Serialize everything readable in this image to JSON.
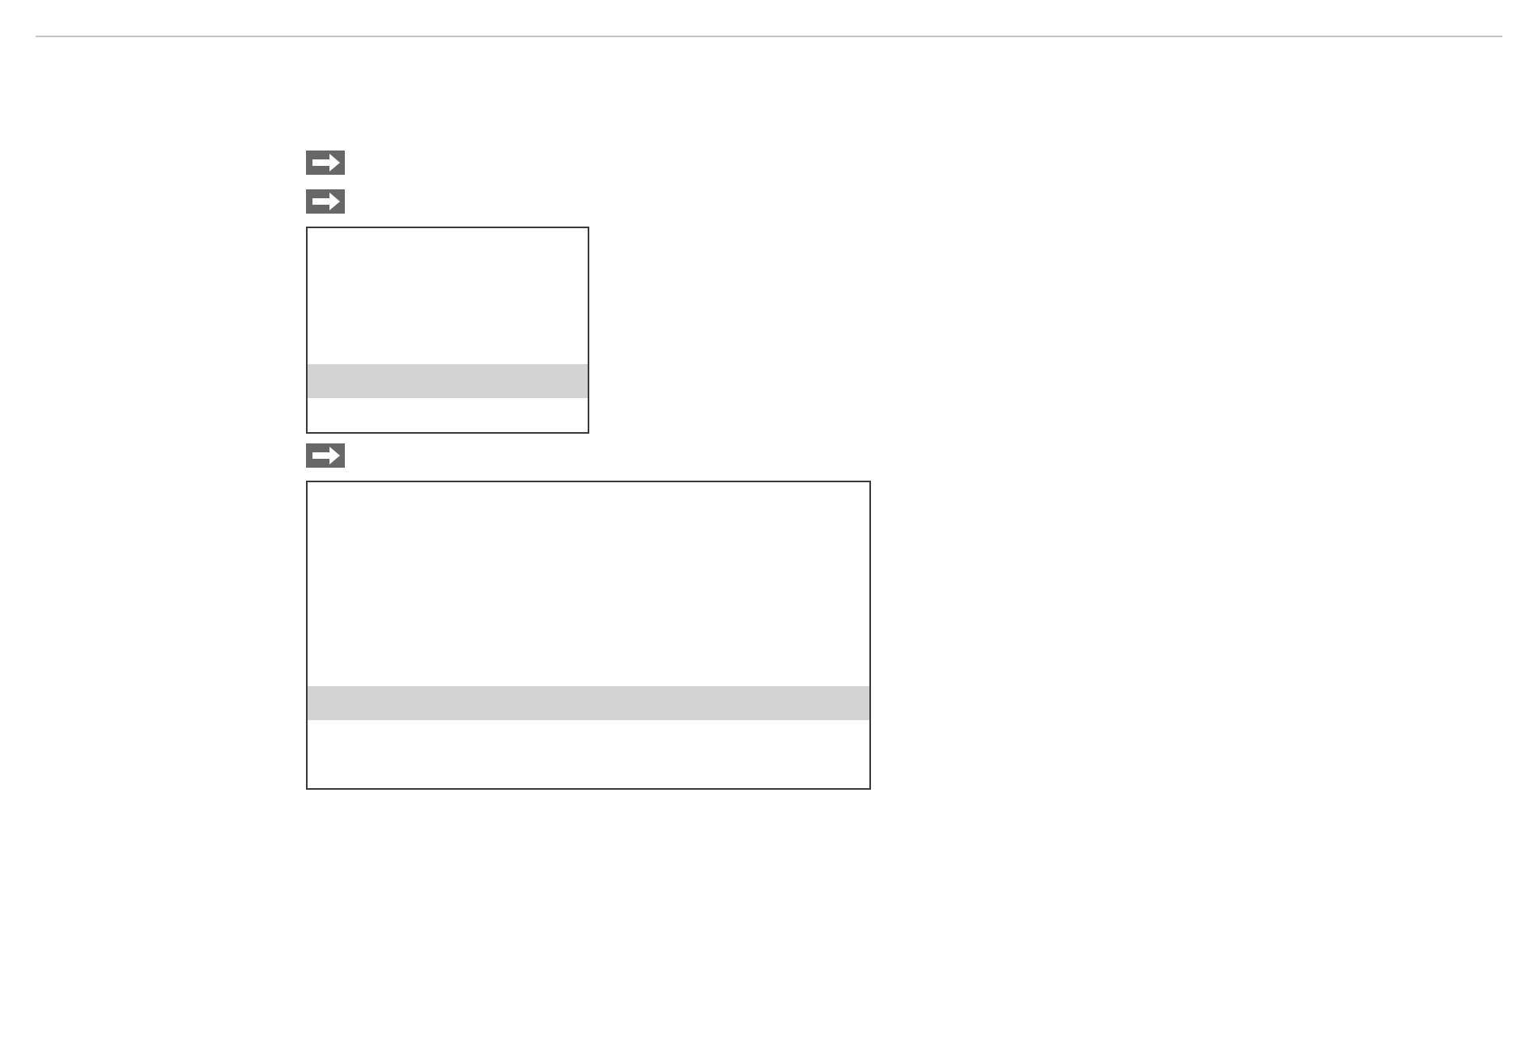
{
  "blocks": [
    {
      "kind": "arrow"
    },
    {
      "kind": "arrow"
    },
    {
      "kind": "screen",
      "rows": [
        {
          "selected": false
        },
        {
          "selected": false
        },
        {
          "selected": false
        },
        {
          "selected": false
        },
        {
          "selected": true
        },
        {
          "selected": false
        }
      ]
    },
    {
      "kind": "arrow"
    },
    {
      "kind": "screen",
      "rows": [
        {
          "selected": false
        },
        {
          "selected": false
        },
        {
          "selected": false
        },
        {
          "selected": false
        },
        {
          "selected": false
        },
        {
          "selected": false
        },
        {
          "selected": true
        },
        {
          "selected": false
        },
        {
          "selected": false
        }
      ]
    }
  ]
}
